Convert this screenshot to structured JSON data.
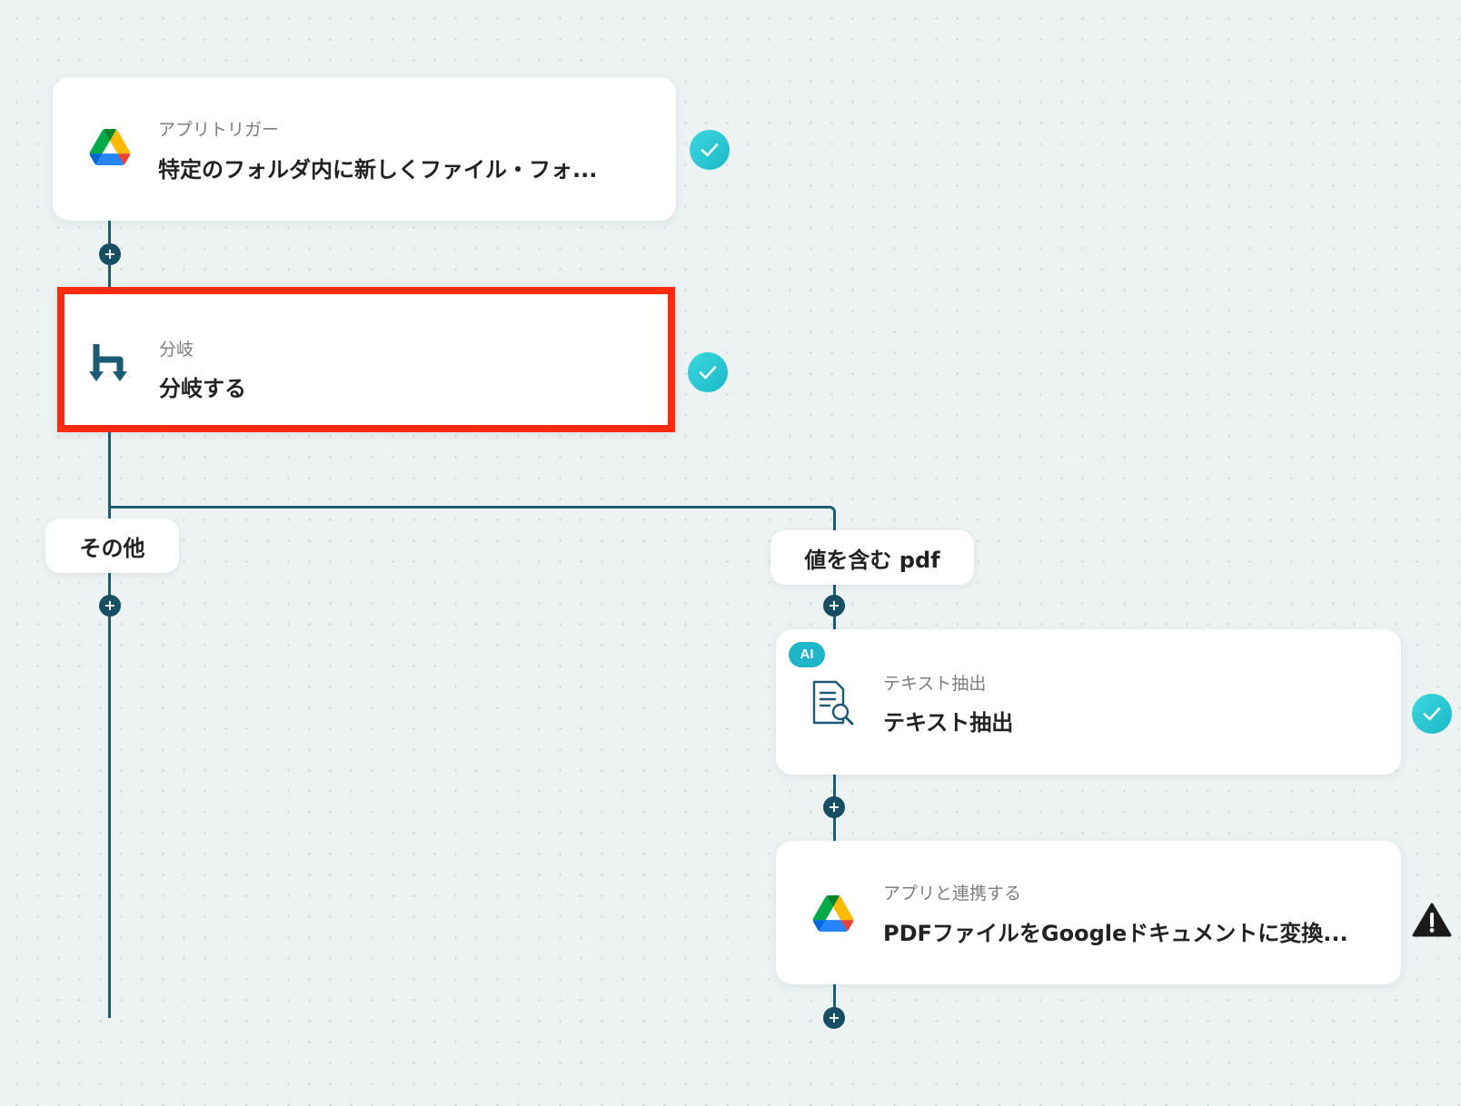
{
  "colors": {
    "connector": "#1c5d72",
    "highlight": "#ff2a10",
    "check": "#1fc0cf",
    "ai_badge": "#1eb5c8"
  },
  "nodes": {
    "trigger": {
      "subtitle": "アプリトリガー",
      "title": "特定のフォルダ内に新しくファイル・フォ...",
      "icon": "google-drive-icon",
      "status": "complete"
    },
    "branch": {
      "subtitle": "分岐",
      "title": "分岐する",
      "icon": "branch-icon",
      "status": "complete"
    },
    "ocr": {
      "badge": "AI",
      "subtitle": "テキスト抽出",
      "title": "テキスト抽出",
      "icon": "document-search-icon",
      "status": "complete"
    },
    "convert": {
      "subtitle": "アプリと連携する",
      "title": "PDFファイルをGoogleドキュメントに変換...",
      "icon": "google-drive-icon",
      "status": "warning"
    }
  },
  "branches": {
    "left": {
      "label": "その他"
    },
    "right": {
      "label": "値を含む pdf"
    }
  },
  "add_step_symbol": "+"
}
